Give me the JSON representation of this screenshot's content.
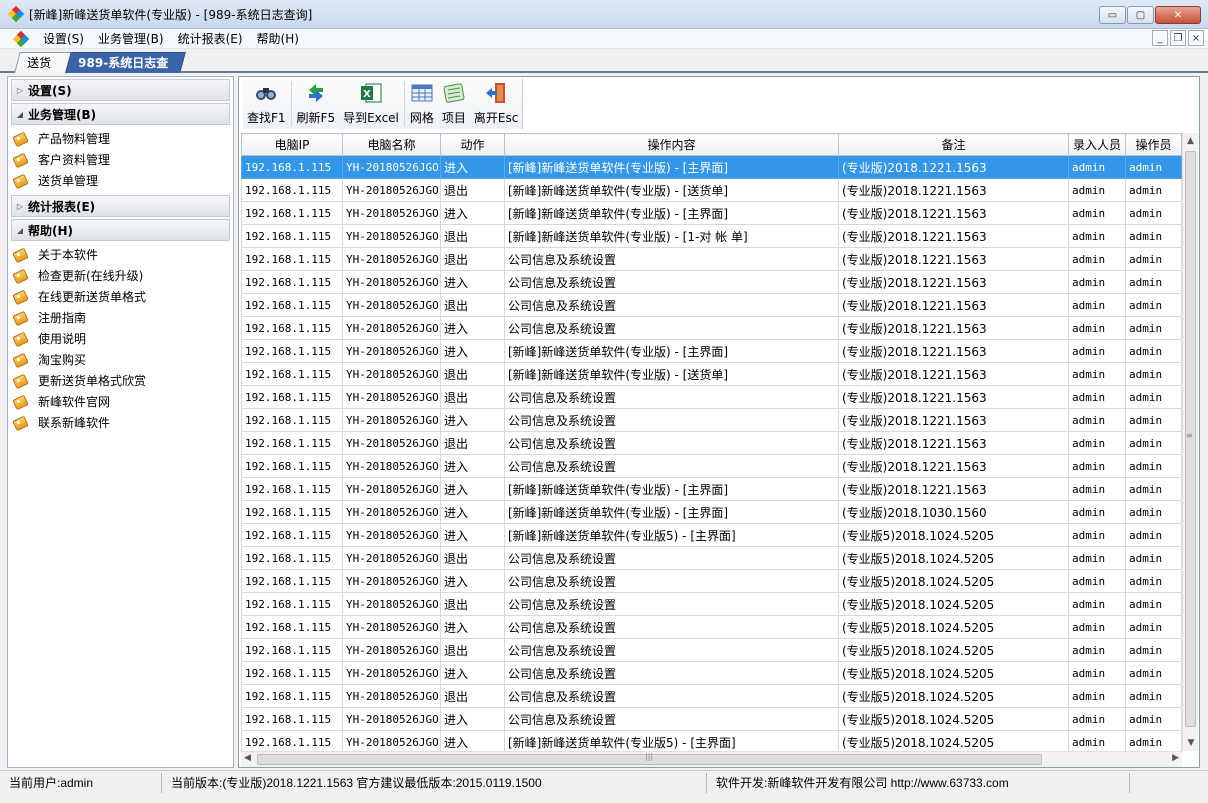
{
  "window": {
    "title": "[新峰]新峰送货单软件(专业版) - [989-系统日志查询]",
    "min_label": "▭",
    "max_label": "▢",
    "close_label": "✕"
  },
  "menu": {
    "items": [
      "设置(S)",
      "业务管理(B)",
      "统计报表(E)",
      "帮助(H)"
    ],
    "mdi_min": "_",
    "mdi_restore": "❐",
    "mdi_close": "×"
  },
  "tabs": [
    "送货单",
    "989-系统日志查询"
  ],
  "nav": {
    "sections": [
      {
        "title": "设置(S)",
        "arrow": "▷",
        "items": []
      },
      {
        "title": "业务管理(B)",
        "arrow": "◢",
        "items": [
          "产品物料管理",
          "客户资料管理",
          "送货单管理"
        ]
      },
      {
        "title": "统计报表(E)",
        "arrow": "▷",
        "items": []
      },
      {
        "title": "帮助(H)",
        "arrow": "◢",
        "items": [
          "关于本软件",
          "检查更新(在线升级)",
          "在线更新送货单格式",
          "注册指南",
          "使用说明",
          "淘宝购买",
          "更新送货单格式欣赏",
          "新峰软件官网",
          "联系新峰软件"
        ]
      }
    ]
  },
  "toolbar": {
    "buttons": [
      {
        "label": "查找F1",
        "icon": "binoculars-icon"
      },
      {
        "label": "刷新F5",
        "icon": "refresh-icon"
      },
      {
        "label": "导到Excel",
        "icon": "excel-icon"
      },
      {
        "label": "网格",
        "icon": "grid-icon"
      },
      {
        "label": "项目",
        "icon": "items-icon"
      },
      {
        "label": "离开Esc",
        "icon": "exit-icon"
      }
    ]
  },
  "grid": {
    "columns": [
      "电脑IP",
      "电脑名称",
      "动作",
      "操作内容",
      "备注",
      "录入人员",
      "操作员"
    ],
    "selected_row": 0,
    "rows": [
      [
        "192.168.1.115",
        "YH-20180526JGOI",
        "进入",
        "[新峰]新峰送货单软件(专业版) - [主界面]",
        "(专业版)2018.1221.1563",
        "admin",
        "admin"
      ],
      [
        "192.168.1.115",
        "YH-20180526JGOI",
        "退出",
        "[新峰]新峰送货单软件(专业版) - [送货单]",
        "(专业版)2018.1221.1563",
        "admin",
        "admin"
      ],
      [
        "192.168.1.115",
        "YH-20180526JGOI",
        "进入",
        "[新峰]新峰送货单软件(专业版) - [主界面]",
        "(专业版)2018.1221.1563",
        "admin",
        "admin"
      ],
      [
        "192.168.1.115",
        "YH-20180526JGOI",
        "退出",
        "[新峰]新峰送货单软件(专业版) - [1-对 帐 单]",
        "(专业版)2018.1221.1563",
        "admin",
        "admin"
      ],
      [
        "192.168.1.115",
        "YH-20180526JGOI",
        "退出",
        "公司信息及系统设置",
        "(专业版)2018.1221.1563",
        "admin",
        "admin"
      ],
      [
        "192.168.1.115",
        "YH-20180526JGOI",
        "进入",
        "公司信息及系统设置",
        "(专业版)2018.1221.1563",
        "admin",
        "admin"
      ],
      [
        "192.168.1.115",
        "YH-20180526JGOI",
        "退出",
        "公司信息及系统设置",
        "(专业版)2018.1221.1563",
        "admin",
        "admin"
      ],
      [
        "192.168.1.115",
        "YH-20180526JGOI",
        "进入",
        "公司信息及系统设置",
        "(专业版)2018.1221.1563",
        "admin",
        "admin"
      ],
      [
        "192.168.1.115",
        "YH-20180526JGOI",
        "进入",
        "[新峰]新峰送货单软件(专业版) - [主界面]",
        "(专业版)2018.1221.1563",
        "admin",
        "admin"
      ],
      [
        "192.168.1.115",
        "YH-20180526JGOI",
        "退出",
        "[新峰]新峰送货单软件(专业版) - [送货单]",
        "(专业版)2018.1221.1563",
        "admin",
        "admin"
      ],
      [
        "192.168.1.115",
        "YH-20180526JGOI",
        "退出",
        "公司信息及系统设置",
        "(专业版)2018.1221.1563",
        "admin",
        "admin"
      ],
      [
        "192.168.1.115",
        "YH-20180526JGOI",
        "进入",
        "公司信息及系统设置",
        "(专业版)2018.1221.1563",
        "admin",
        "admin"
      ],
      [
        "192.168.1.115",
        "YH-20180526JGOI",
        "退出",
        "公司信息及系统设置",
        "(专业版)2018.1221.1563",
        "admin",
        "admin"
      ],
      [
        "192.168.1.115",
        "YH-20180526JGOI",
        "进入",
        "公司信息及系统设置",
        "(专业版)2018.1221.1563",
        "admin",
        "admin"
      ],
      [
        "192.168.1.115",
        "YH-20180526JGOI",
        "进入",
        "[新峰]新峰送货单软件(专业版) - [主界面]",
        "(专业版)2018.1221.1563",
        "admin",
        "admin"
      ],
      [
        "192.168.1.115",
        "YH-20180526JGOI",
        "进入",
        "[新峰]新峰送货单软件(专业版) - [主界面]",
        "(专业版)2018.1030.1560",
        "admin",
        "admin"
      ],
      [
        "192.168.1.115",
        "YH-20180526JGOI",
        "进入",
        "[新峰]新峰送货单软件(专业版5) - [主界面]",
        "(专业版5)2018.1024.5205",
        "admin",
        "admin"
      ],
      [
        "192.168.1.115",
        "YH-20180526JGOI",
        "退出",
        "公司信息及系统设置",
        "(专业版5)2018.1024.5205",
        "admin",
        "admin"
      ],
      [
        "192.168.1.115",
        "YH-20180526JGOI",
        "进入",
        "公司信息及系统设置",
        "(专业版5)2018.1024.5205",
        "admin",
        "admin"
      ],
      [
        "192.168.1.115",
        "YH-20180526JGOI",
        "退出",
        "公司信息及系统设置",
        "(专业版5)2018.1024.5205",
        "admin",
        "admin"
      ],
      [
        "192.168.1.115",
        "YH-20180526JGOI",
        "进入",
        "公司信息及系统设置",
        "(专业版5)2018.1024.5205",
        "admin",
        "admin"
      ],
      [
        "192.168.1.115",
        "YH-20180526JGOI",
        "退出",
        "公司信息及系统设置",
        "(专业版5)2018.1024.5205",
        "admin",
        "admin"
      ],
      [
        "192.168.1.115",
        "YH-20180526JGOI",
        "进入",
        "公司信息及系统设置",
        "(专业版5)2018.1024.5205",
        "admin",
        "admin"
      ],
      [
        "192.168.1.115",
        "YH-20180526JGOI",
        "退出",
        "公司信息及系统设置",
        "(专业版5)2018.1024.5205",
        "admin",
        "admin"
      ],
      [
        "192.168.1.115",
        "YH-20180526JGOI",
        "进入",
        "公司信息及系统设置",
        "(专业版5)2018.1024.5205",
        "admin",
        "admin"
      ],
      [
        "192.168.1.115",
        "YH-20180526JGOI",
        "进入",
        "[新峰]新峰送货单软件(专业版5) - [主界面]",
        "(专业版5)2018.1024.5205",
        "admin",
        "admin"
      ]
    ]
  },
  "scroll": {
    "up": "▲",
    "down": "▼",
    "left": "◀",
    "right": "▶",
    "grip": "|||"
  },
  "status": {
    "user": "当前用户:admin",
    "version": "当前版本:(专业版)2018.1221.1563 官方建议最低版本:2015.0119.1500",
    "developer": "软件开发:新峰软件开发有限公司 http://www.63733.com",
    "extra": ""
  },
  "colors": {
    "selection": "#3396e8",
    "active_tab": "#3a64a8"
  }
}
